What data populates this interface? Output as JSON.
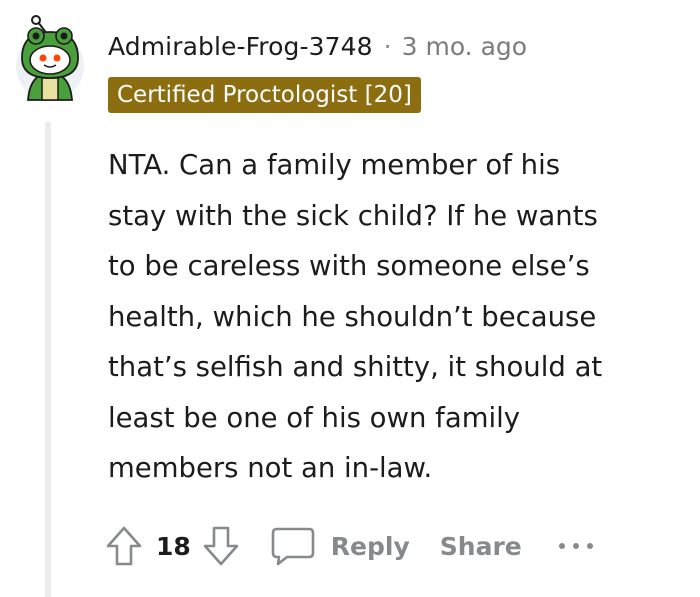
{
  "comment": {
    "username": "Admirable-Frog-3748",
    "separator": "·",
    "timestamp": "3 mo. ago",
    "flair": "Certified Proctologist [20]",
    "body": "NTA. Can a family member of his stay with the sick child? If he wants to be careless with someone else’s health, which he shouldn’t because that’s selfish and shitty, it should at least be one of his own family members not an in-law.",
    "body_lines": [
      "NTA. Can a family member of his",
      "stay with the sick child? If he wants",
      "to be careless with someone else’s",
      "health, which he shouldn’t because",
      "that’s selfish and shitty, it should at",
      "least be one of his own family",
      "members not an in-law."
    ]
  },
  "actions": {
    "upvote_icon": "upvote-arrow-icon",
    "vote_count": "18",
    "downvote_icon": "downvote-arrow-icon",
    "comment_icon": "comment-bubble-icon",
    "reply_label": "Reply",
    "share_label": "Share",
    "more_icon": "more-options-icon"
  },
  "colors": {
    "flair_background": "#8c6d10",
    "flair_text": "#ffffff",
    "avatar_green": "#49a03a",
    "avatar_accent": "#e8e1a0",
    "muted_text": "#878a8c"
  }
}
